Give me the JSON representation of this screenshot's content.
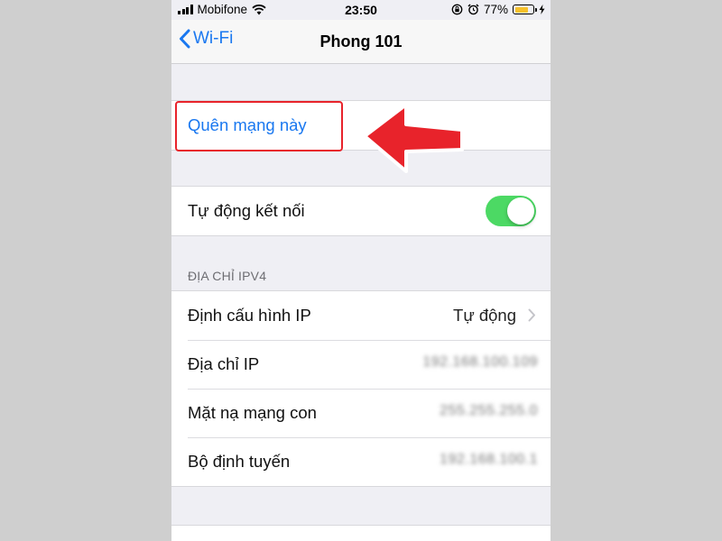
{
  "status_bar": {
    "carrier": "Mobifone",
    "time": "23:50",
    "battery_percent": "77%",
    "battery_level": 0.77,
    "battery_color": "#f7c12b"
  },
  "nav": {
    "back_label": "Wi-Fi",
    "title": "Phong 101"
  },
  "actions": {
    "forget_label": "Quên mạng này"
  },
  "auto_join": {
    "label": "Tự động kết nối",
    "enabled": true,
    "toggle_color": "#4cd964"
  },
  "ipv4": {
    "header": "ĐỊA CHỈ IPV4",
    "rows": [
      {
        "label": "Định cấu hình IP",
        "value": "Tự động"
      },
      {
        "label": "Địa chỉ IP",
        "value": "192.168.100.109"
      },
      {
        "label": "Mặt nạ mạng con",
        "value": "255.255.255.0"
      },
      {
        "label": "Bộ định tuyến",
        "value": "192.168.100.1"
      }
    ]
  },
  "colors": {
    "accent": "#1a78f0",
    "annotation": "#e8232b"
  }
}
